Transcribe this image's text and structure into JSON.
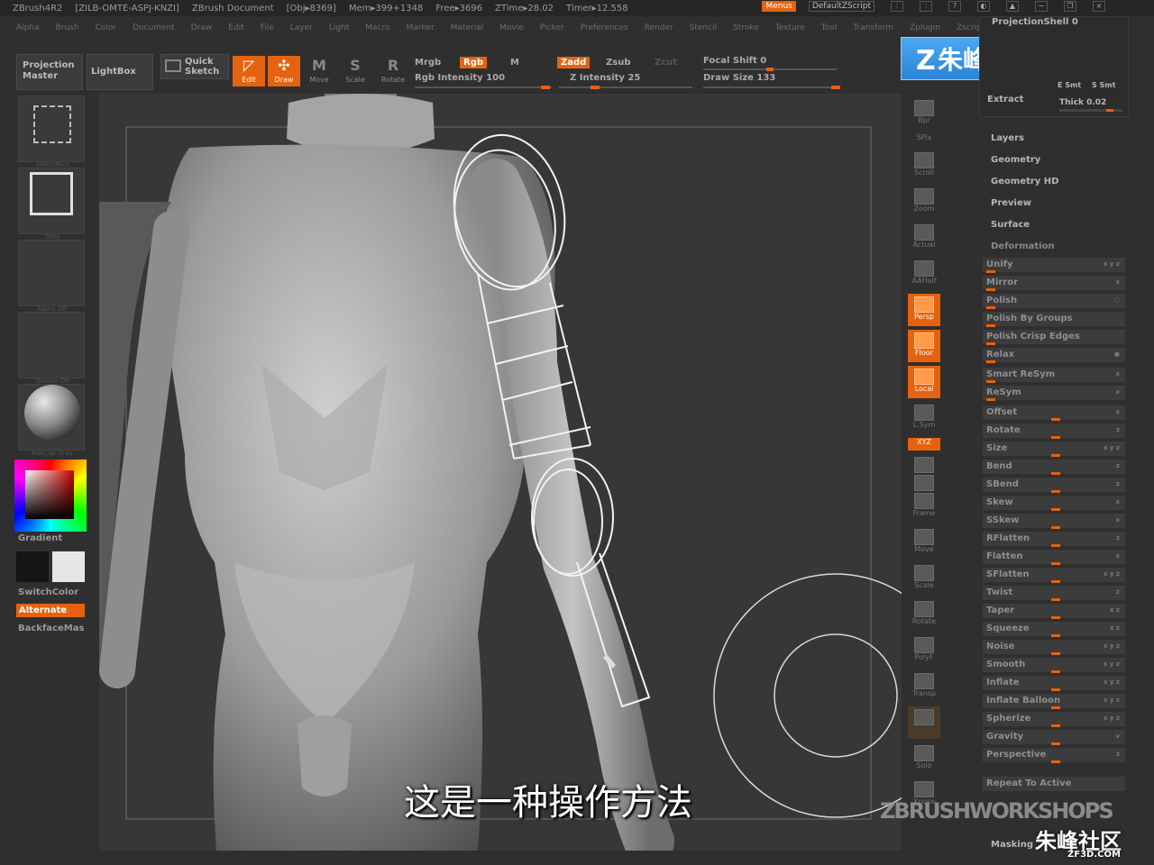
{
  "titlebar": {
    "app": "ZBrush4R2",
    "id": "[ZILB-OMTE-ASPJ-KNZI]",
    "doc": "ZBrush Document",
    "obj": "[Obj▸8369]",
    "mem": "Mem▸399+1348",
    "free": "Free▸3696",
    "ztime": "ZTime▸28.02",
    "timer": "Timer▸12.558",
    "menus": "Menus",
    "script": "DefaultZScript"
  },
  "menubar": [
    "Alpha",
    "Brush",
    "Color",
    "Document",
    "Draw",
    "Edit",
    "File",
    "Layer",
    "Light",
    "Macro",
    "Marker",
    "Material",
    "Movie",
    "Picker",
    "Preferences",
    "Render",
    "Stencil",
    "Stroke",
    "Texture",
    "Tool",
    "Transform",
    "Zplugin",
    "Zscript"
  ],
  "shelf": {
    "projection_master_1": "Projection",
    "projection_master_2": "Master",
    "lightbox": "LightBox",
    "quick_sketch_1": "Quick",
    "quick_sketch_2": "Sketch",
    "edit": "Edit",
    "draw": "Draw",
    "move": "Move",
    "scale": "Scale",
    "rotate": "Rotate",
    "mrgb": "Mrgb",
    "rgb": "Rgb",
    "m": "M",
    "rgb_intensity": "Rgb Intensity 100",
    "zadd": "Zadd",
    "zsub": "Zsub",
    "zcut": "Zcut",
    "z_intensity": "Z Intensity 25",
    "focal_shift": "Focal Shift 0",
    "draw_size": "Draw Size 133",
    "rgb_intensity_value": 100,
    "z_intensity_value": 25,
    "draw_size_value": 133
  },
  "logo": {
    "text": "朱峰社区",
    "glyph": "Z"
  },
  "left": {
    "tile1": "SelectRect",
    "tile2": "Dots",
    "tile3": "Alpha Off",
    "tile4": "Texture Off",
    "tile5": "MatCap Gray",
    "gradient": "Gradient",
    "switchcolor": "SwitchColor",
    "alternate": "Alternate",
    "backface": "BackfaceMas"
  },
  "rtools": [
    "Bpr",
    "SPix",
    "Scroll",
    "Zoom",
    "Actual",
    "AAHalf",
    "Persp",
    "Floor",
    "Local",
    "L.Sym",
    "XYZ",
    "",
    "",
    "Frame",
    "Move",
    "Scale",
    "Rotate",
    "PolyF",
    "Transp",
    "",
    "Solo",
    "Xpose"
  ],
  "rpanel_top": {
    "projection_shell": "ProjectionShell 0",
    "extract": "Extract",
    "e_smt": "E Smt",
    "s_smt": "S Smt",
    "thick": "Thick 0.02"
  },
  "sections": [
    "Layers",
    "Geometry",
    "Geometry HD",
    "Preview",
    "Surface",
    "Deformation"
  ],
  "deform_rows": [
    {
      "label": "Unify",
      "k": "x y z"
    },
    {
      "label": "Mirror",
      "k": "x"
    },
    {
      "label": "Polish",
      "k": "○"
    },
    {
      "label": "Polish By Groups",
      "k": ""
    },
    {
      "label": "Polish Crisp Edges",
      "k": ""
    },
    {
      "label": "Relax",
      "k": "●"
    },
    {
      "label": "Smart ReSym",
      "k": "x"
    },
    {
      "label": "ReSym",
      "k": "x"
    },
    {
      "label": "Offset",
      "k": "x"
    },
    {
      "label": "Rotate",
      "k": "z"
    },
    {
      "label": "Size",
      "k": "x y z"
    },
    {
      "label": "Bend",
      "k": "z"
    },
    {
      "label": "SBend",
      "k": "z"
    },
    {
      "label": "Skew",
      "k": "x"
    },
    {
      "label": "SSkew",
      "k": "x"
    },
    {
      "label": "RFlatten",
      "k": "z"
    },
    {
      "label": "Flatten",
      "k": "x"
    },
    {
      "label": "SFlatten",
      "k": "x y z"
    },
    {
      "label": "Twist",
      "k": "z"
    },
    {
      "label": "Taper",
      "k": "x z"
    },
    {
      "label": "Squeeze",
      "k": "x z"
    },
    {
      "label": "Noise",
      "k": "x y z"
    },
    {
      "label": "Smooth",
      "k": "x y z"
    },
    {
      "label": "Inflate",
      "k": "x y z"
    },
    {
      "label": "Inflate Balloon",
      "k": "x y z"
    },
    {
      "label": "Spherize",
      "k": "x y z"
    },
    {
      "label": "Gravity",
      "k": "v"
    },
    {
      "label": "Perspective",
      "k": "z"
    }
  ],
  "repeat": "Repeat To Active",
  "masking": "Masking",
  "subtitle": "这是一种操作方法",
  "watermark1": "ZBRUSHWORKSHOPS",
  "watermark2": "朱峰社区",
  "watermark2_url": "ZF3D.COM",
  "colors": {
    "accent": "#e5630f",
    "bg": "#2f2f2f",
    "canvas": "#373737"
  }
}
